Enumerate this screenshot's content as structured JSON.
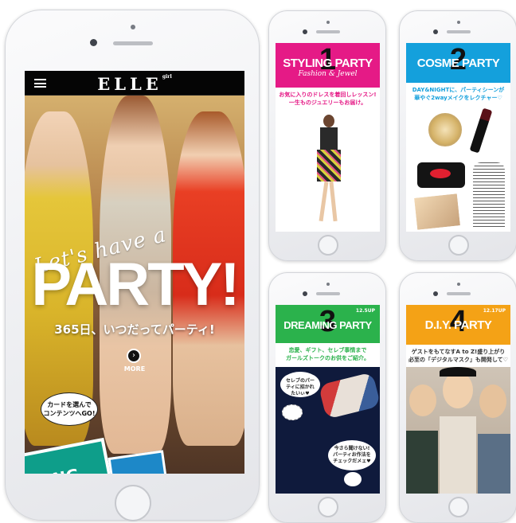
{
  "main_phone": {
    "brand": "ELLE",
    "brand_small": "girl",
    "cursive": "Let's have a",
    "headline": "PARTY!",
    "subhead": "365日、いつだってパーティ!",
    "more_label": "MORE",
    "bubble_line1": "カードを選んで",
    "bubble_line2": "コンテンツへGO!",
    "card_text": "NG"
  },
  "cards": [
    {
      "num": "1",
      "title": "STYLING PARTY",
      "script": "Fashion & Jewel",
      "update": "",
      "desc1": "お気に入りのドレスを着回しレッスン!",
      "desc2": "一生ものジュエリーもお届け。",
      "color": "#e51a86"
    },
    {
      "num": "2",
      "title": "COSME PARTY",
      "script": "",
      "update": "",
      "desc1": "DAY&NIGHTに、パーティシーンが",
      "desc2": "華やぐ2wayメイクをレクチャー♡",
      "color": "#14a0dc"
    },
    {
      "num": "3",
      "title": "DREAMING PARTY",
      "script": "",
      "update": "12.5UP",
      "desc1": "恋愛、ギフト、セレブ事情まで",
      "desc2": "ガールズトークのお供をご紹介。",
      "color": "#2bb24c",
      "bubble1": "セレブのパーティに招かれたいぃ♥",
      "bubble2": "今さら聞けない!パーティお作法をチェックだメェ♥"
    },
    {
      "num": "4",
      "title": "D.I.Y. PARTY",
      "script": "",
      "update": "12.17UP",
      "desc1": "ゲストをもてなすA to Z!盛り上がり",
      "desc2": "必至の「デジタルマスク」も開発して♡",
      "color": "#f4a216"
    }
  ],
  "colors": {
    "magenta": "#e51a86",
    "cyan": "#14a0dc",
    "green": "#2bb24c",
    "orange": "#f4a216",
    "navy": "#0f1a3c"
  }
}
